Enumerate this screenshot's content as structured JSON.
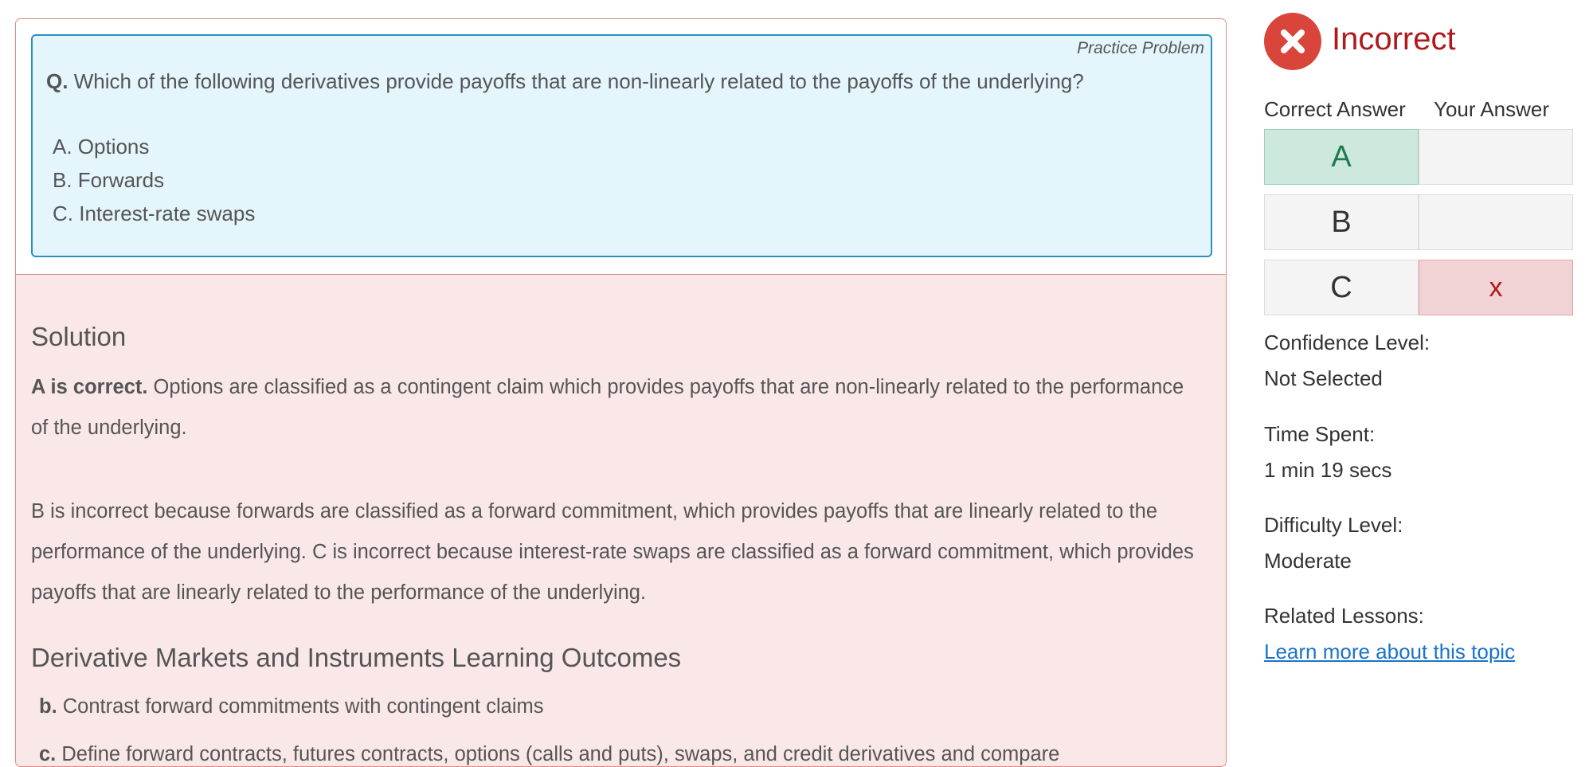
{
  "question": {
    "practice_label": "Practice Problem",
    "prefix": "Q.",
    "text": "Which of the following derivatives provide payoffs that are non-linearly related to the payoffs of the underlying?",
    "options": [
      "A. Options",
      "B. Forwards",
      "C. Interest-rate swaps"
    ]
  },
  "solution": {
    "title": "Solution",
    "correct_lead": "A is correct.",
    "correct_text": "Options are classified as a contingent claim which provides payoffs that are non-linearly related to the performance of the underlying.",
    "incorrect_text": "B is incorrect because forwards are classified as a forward commitment, which provides payoffs that are linearly related to the performance of the underlying. C is incorrect because interest-rate swaps are classified as a forward commitment, which provides payoffs that are linearly related to the performance of the underlying."
  },
  "learning_outcomes": {
    "title": "Derivative Markets and Instruments Learning Outcomes",
    "items": [
      {
        "letter": "b.",
        "text": "Contrast forward commitments with contingent claims"
      },
      {
        "letter": "c.",
        "text": "Define forward contracts, futures contracts, options (calls and puts), swaps, and credit derivatives and compare"
      }
    ]
  },
  "result": {
    "status": "Incorrect",
    "status_color": "#b0191c",
    "icon": "x-circle-icon",
    "headers": {
      "correct": "Correct Answer",
      "yours": "Your Answer"
    },
    "rows": [
      {
        "correct": "A",
        "yours": ""
      },
      {
        "correct": "B",
        "yours": ""
      },
      {
        "correct": "C",
        "yours": "x"
      }
    ]
  },
  "meta": {
    "confidence_label": "Confidence Level:",
    "confidence_value": "Not Selected",
    "time_label": "Time Spent:",
    "time_value": "1 min 19 secs",
    "difficulty_label": "Difficulty Level:",
    "difficulty_value": "Moderate",
    "related_label": "Related Lessons:",
    "related_link": "Learn more about this topic"
  },
  "colors": {
    "solution_background": "#f9e8e7",
    "question_background": "#e4f5fc",
    "correct_cell": "#cde9de",
    "wrong_cell": "#f1d3d5",
    "link": "#1a73c9"
  }
}
